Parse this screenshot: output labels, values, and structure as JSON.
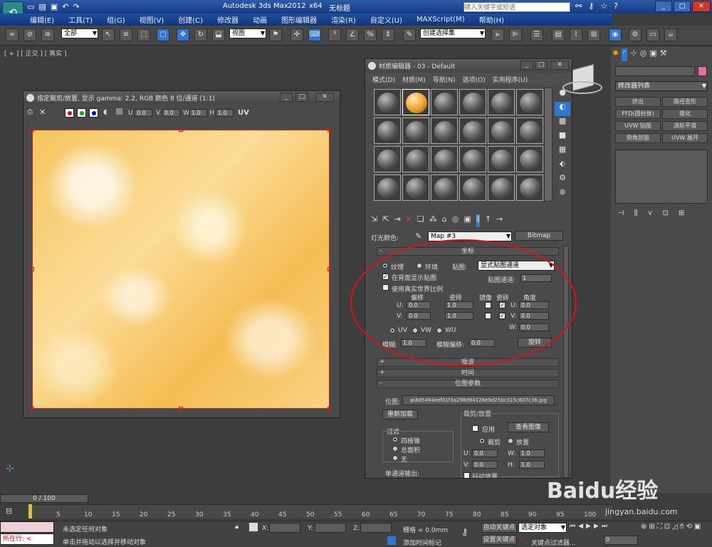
{
  "app": {
    "title_left": "Autodesk 3ds Max",
    "version": "2012",
    "bits": "x64",
    "doc": "无标题",
    "search_placeholder": "键入关键字或短语"
  },
  "menu": [
    "编辑(E)",
    "工具(T)",
    "组(G)",
    "视图(V)",
    "创建(C)",
    "修改器",
    "动画",
    "图形编辑器",
    "渲染(R)",
    "自定义(U)",
    "MAXScript(M)",
    "帮助(H)"
  ],
  "toolbar": {
    "filter": "全部",
    "refcoord": "视图",
    "selset": "创建选择集"
  },
  "viewport": {
    "label": "[ + ] [ 正交 ] [ 真实 ]"
  },
  "crop": {
    "title": "指定裁剪/放置, 显示 gamma: 2.2, RGB 颜色 8 位/通道 (1:1)",
    "u_label": "U",
    "u": "0.0",
    "v_label": "V",
    "v": "0.0",
    "w_label": "W",
    "w": "1.0",
    "h_label": "H",
    "h": "1.0",
    "uv": "UV"
  },
  "mat": {
    "title": "材质编辑器 - 03 - Default",
    "menu": [
      "模式(D)",
      "材质(M)",
      "导航(N)",
      "选项(O)",
      "实用程序(U)"
    ],
    "light_label": "灯光颜色:",
    "map_name": "Map #3",
    "map_type": "Bitmap",
    "coords": {
      "header": "坐标",
      "texture": "纹理",
      "env": "环境",
      "mapping_label": "贴图:",
      "mapping": "显式贴图通道",
      "show_back": "在背面显示贴图",
      "map_channel_label": "贴图通道:",
      "map_channel": "1",
      "real_world": "使用真实世界比例",
      "offset": "偏移",
      "tiling": "瓷砖",
      "mirror": "镜像",
      "tile": "瓷砖",
      "angle": "角度",
      "u": "U:",
      "v": "V:",
      "w": "W:",
      "off_u": "0.0",
      "off_v": "0.0",
      "til_u": "1.0",
      "til_v": "1.0",
      "ang_u": "0.0",
      "ang_v": "0.0",
      "ang_w": "0.0",
      "uv": "UV",
      "vw": "VW",
      "wu": "WU",
      "blur_label": "模糊:",
      "blur": "1.0",
      "bluroff_label": "模糊偏移:",
      "bluroff": "0.0",
      "rotate": "旋转"
    },
    "noise": "噪波",
    "time": "时间",
    "bitmap": {
      "header": "位图参数",
      "path_label": "位图:",
      "path": "φ\\8d5494eef01f3a298d94126e9d25bc315c607c36.jpg",
      "reload": "重新加载",
      "filter_label": "过滤",
      "pyramid": "四棱锥",
      "summed": "总面积",
      "none": "无",
      "crop_label": "裁剪/放置",
      "apply": "应用",
      "view": "查看图像",
      "crop": "裁剪",
      "place": "放置",
      "u": "U:",
      "v": "V:",
      "w": "W:",
      "h": "H:",
      "cu": "0.0",
      "cv": "0.0",
      "cw": "1.0",
      "ch": "1.0",
      "mono": "单通道输出:",
      "jitter": "抖动放置"
    }
  },
  "cmd": {
    "modlist": "修改器列表",
    "btns": [
      "挤出",
      "路径变形",
      "FFD(圆柱体)",
      "锥化",
      "UVW 贴图",
      "涡轮平滑",
      "倒角剖面",
      "UVW 展开"
    ]
  },
  "timeline": {
    "frame": "0 / 100",
    "ticks": [
      "0",
      "5",
      "10",
      "15",
      "20",
      "25",
      "30",
      "35",
      "40",
      "45",
      "50",
      "55",
      "60",
      "65",
      "70",
      "75",
      "80",
      "85",
      "90",
      "95",
      "100"
    ]
  },
  "status": {
    "left": "所在行: <",
    "sel": "未选定任何对象",
    "prompt": "单击并拖动以选择并移动对象",
    "x": "X:",
    "y": "Y:",
    "z": "Z:",
    "grid": "栅格 = 0.0mm",
    "autokey": "自动关键点",
    "setkey": "设置关键点",
    "keymode": "选定对象",
    "addtime": "添加时间标记",
    "keyfilter": "关键点过滤器...",
    "frame": "0"
  },
  "watermark": "Baidu经验",
  "watermark_url": "jingyan.baidu.com",
  "colors": {
    "accent": "#2f77d0",
    "mark": "#e01010"
  }
}
